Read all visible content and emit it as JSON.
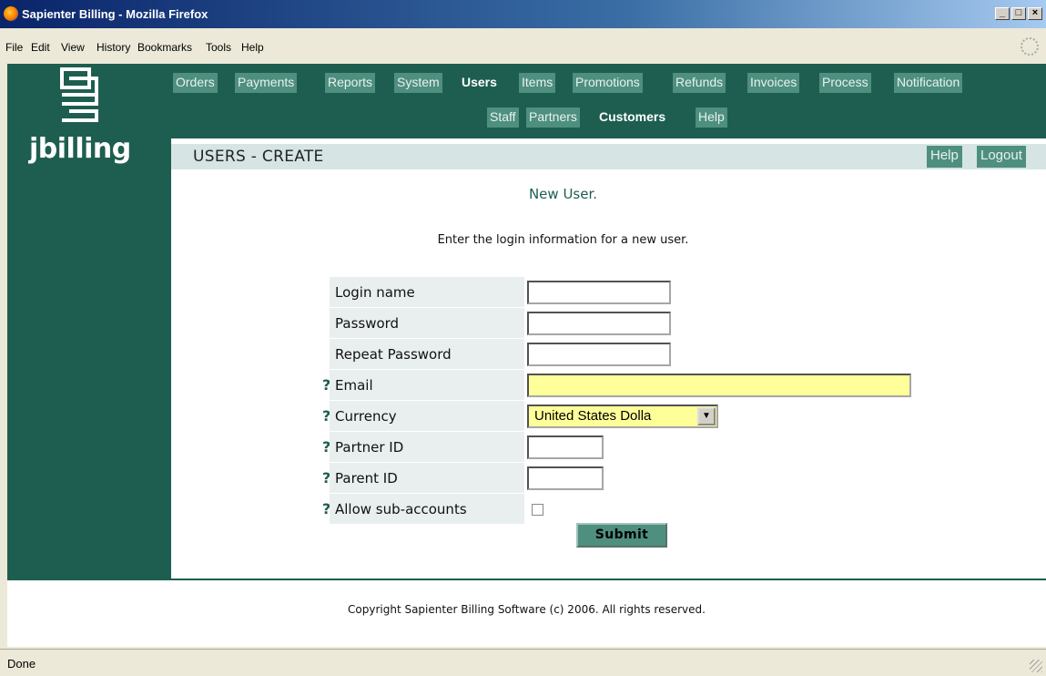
{
  "window": {
    "title": "Sapienter Billing - Mozilla Firefox",
    "buttons": {
      "minimize": "_",
      "maximize": "□",
      "close": "×"
    }
  },
  "menubar": [
    "File",
    "Edit",
    "View",
    "History",
    "Bookmarks",
    "Tools",
    "Help"
  ],
  "logo": {
    "text": "jbilling"
  },
  "nav": {
    "main": [
      "Orders",
      "Payments",
      "Reports",
      "System",
      "Users",
      "Items",
      "Promotions",
      "Refunds",
      "Invoices",
      "Process",
      "Notification"
    ],
    "active_main": "Users",
    "sub": [
      "Staff",
      "Partners",
      "Customers",
      "Help"
    ],
    "active_sub": "Customers"
  },
  "header": {
    "title": "USERS - CREATE",
    "help": "Help",
    "logout": "Logout"
  },
  "form": {
    "heading": "New User.",
    "instructions": "Enter the login information for a new user.",
    "fields": {
      "login_name": {
        "label": "Login name",
        "value": ""
      },
      "password": {
        "label": "Password",
        "value": ""
      },
      "repeat_password": {
        "label": "Repeat Password",
        "value": ""
      },
      "email": {
        "label": "Email",
        "value": ""
      },
      "currency": {
        "label": "Currency",
        "value": "United States Dolla"
      },
      "partner_id": {
        "label": "Partner ID",
        "value": ""
      },
      "parent_id": {
        "label": "Parent ID",
        "value": ""
      },
      "allow_sub_accounts": {
        "label": "Allow sub-accounts",
        "checked": false
      }
    },
    "help_mark": "?",
    "submit": "Submit"
  },
  "footer": {
    "copyright": "Copyright Sapienter Billing Software (c) 2006. All rights reserved."
  },
  "statusbar": {
    "status": "Done"
  },
  "colors": {
    "brand": "#1e5e50",
    "nav_button": "#4e8f7f",
    "subheader": "#d6e4e4",
    "label_bg": "#e9efef",
    "required_field": "#ffff99"
  }
}
